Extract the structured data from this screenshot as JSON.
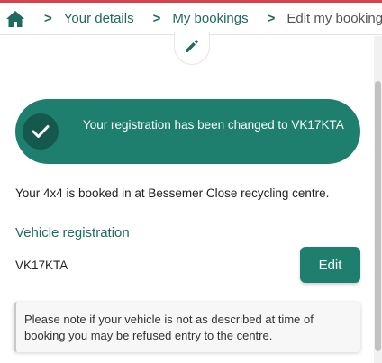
{
  "breadcrumb": {
    "home_icon": "home-icon",
    "separator": ">",
    "items": [
      {
        "label": "Your details"
      },
      {
        "label": "My bookings"
      },
      {
        "label": "Edit my booking"
      }
    ]
  },
  "edit_bubble": {
    "icon": "pencil-icon"
  },
  "banner": {
    "icon": "check-icon",
    "message": "Your registration has been changed to VK17KTA"
  },
  "booking": {
    "info": "Your 4x4 is booked in at Bessemer Close recycling centre."
  },
  "vehicle": {
    "section_title": "Vehicle registration",
    "registration": "VK17KTA",
    "edit_label": "Edit"
  },
  "notice": {
    "text": "Please note if your vehicle is not as described at time of booking you may be refused entry to the centre."
  },
  "colors": {
    "brand_green": "#1e7f6f",
    "dark_green": "#15594e",
    "link_green": "#1e6b5f",
    "top_accent": "#d6434e"
  }
}
